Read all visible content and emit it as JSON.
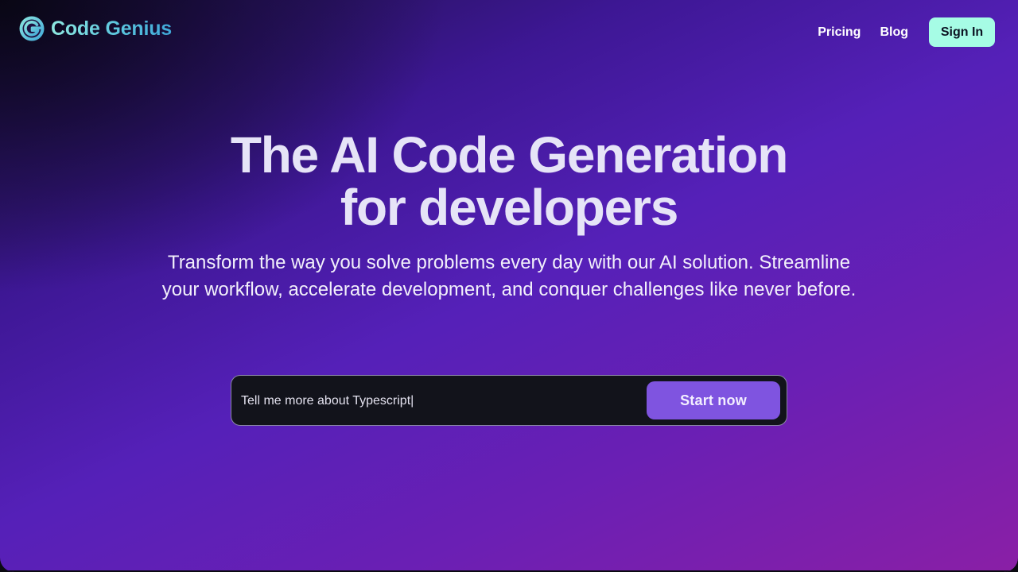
{
  "brand": {
    "name": "Code Genius",
    "logo_icon": "code-genius-logo-icon"
  },
  "nav": {
    "items": [
      {
        "label": "Pricing"
      },
      {
        "label": "Blog"
      }
    ],
    "signin_label": "Sign In"
  },
  "hero": {
    "title_line1": "The AI Code Generation",
    "title_line2": "for developers",
    "subtitle": "Transform the way you solve problems every day with our AI solution. Streamline your workflow, accelerate development, and conquer challenges like never before."
  },
  "prompt": {
    "value": "Tell me more about Typescript|",
    "button_label": "Start now"
  },
  "colors": {
    "accent_button": "#7f54e0",
    "signin_button": "#a6fce5",
    "brand_gradient_start": "#8ee8e0",
    "brand_gradient_end": "#3fa7d8",
    "prompt_background": "#12131b"
  }
}
